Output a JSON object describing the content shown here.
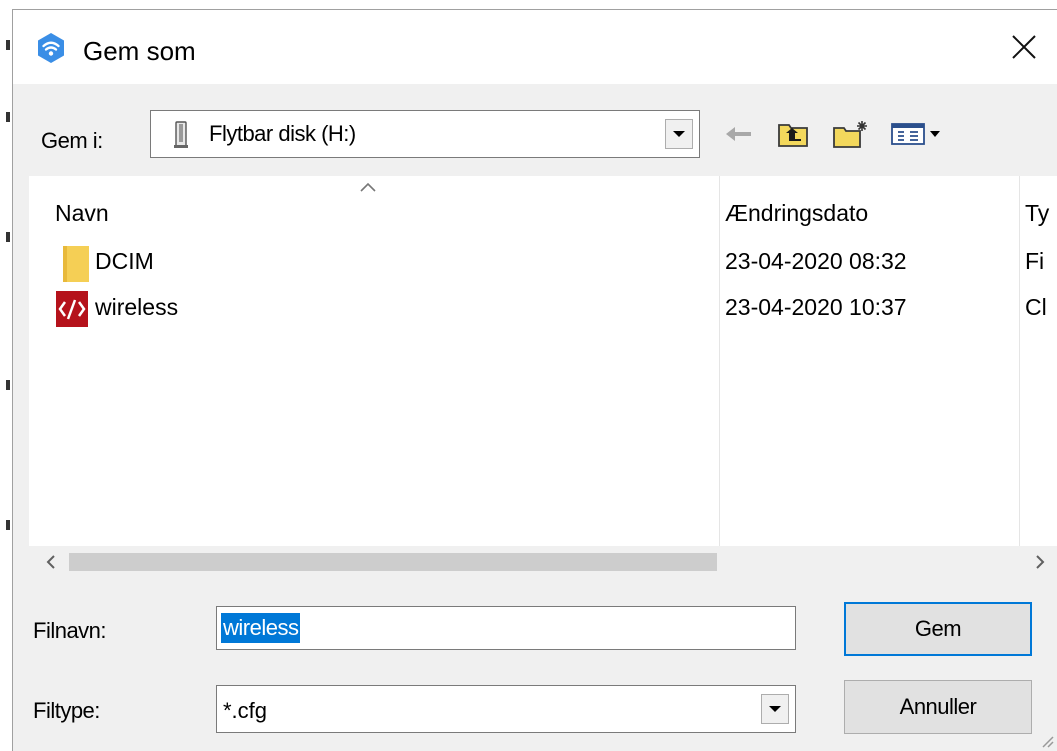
{
  "dialog": {
    "title": "Gem som",
    "look_in_label": "Gem i:",
    "look_in_value": "Flytbar disk (H:)"
  },
  "list": {
    "columns": [
      "Navn",
      "Ændringsdato",
      "Ty"
    ],
    "rows": [
      {
        "name": "DCIM",
        "date": "23-04-2020 08:32",
        "type": "Fi"
      },
      {
        "name": "wireless",
        "date": "23-04-2020 10:37",
        "type": "Cl"
      }
    ]
  },
  "form": {
    "filename_label": "Filnavn:",
    "filename_value": "wireless",
    "filetype_label": "Filtype:",
    "filetype_value": "*.cfg"
  },
  "buttons": {
    "save": "Gem",
    "cancel": "Annuller"
  },
  "icons": [
    "wifi-app-icon",
    "close-icon",
    "drive-icon",
    "back-arrow-icon",
    "up-folder-icon",
    "new-folder-icon",
    "view-menu-icon",
    "folder-icon",
    "cfg-file-icon"
  ],
  "colors": {
    "selection": "#0078d7",
    "app_icon": "#3a8ee6",
    "cfg_icon": "#b5121b",
    "folder": "#f3c94a"
  }
}
